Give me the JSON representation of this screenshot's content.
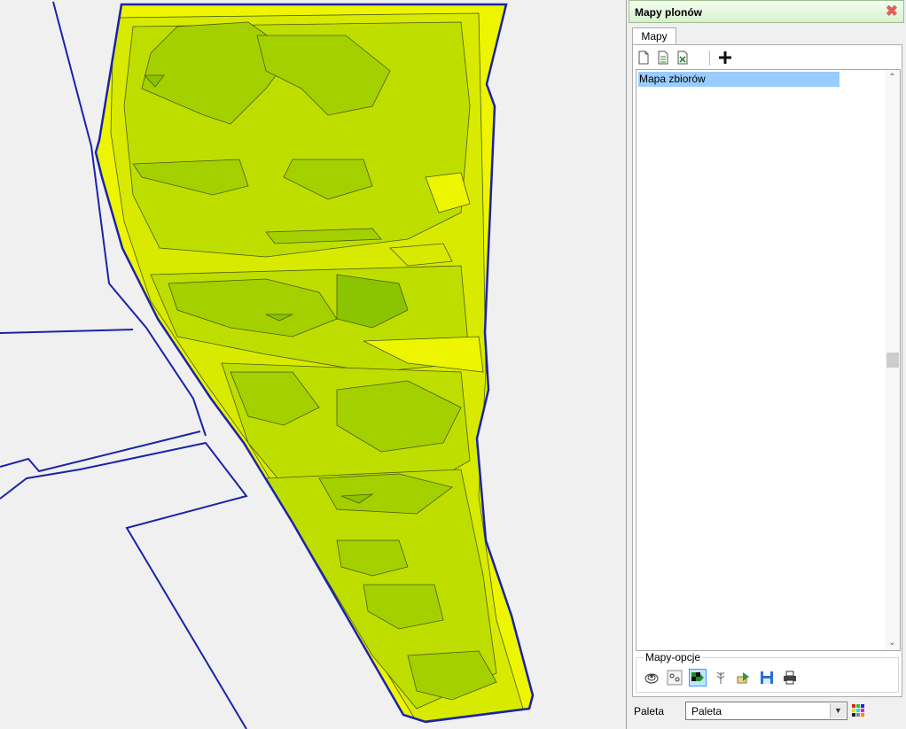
{
  "panel": {
    "title": "Mapy plonów",
    "close_icon": "close-icon",
    "tab_label": "Mapy",
    "toolbar_icons": [
      "new-document-icon",
      "edit-document-icon",
      "delete-document-icon",
      "add-icon"
    ],
    "list_items": [
      "Mapa zbiorów"
    ],
    "options_label": "Mapy-opcje",
    "option_icons": [
      "layers-icon",
      "points-icon",
      "map-grid-icon",
      "crop-icon",
      "export-icon",
      "save-icon",
      "print-icon"
    ],
    "palette_label": "Paleta",
    "palette_value": "Paleta",
    "palette_icon": "palette-icon"
  },
  "colors": {
    "boundary": "#1a23a8",
    "header_bg": "#dff3d6",
    "selection": "#99ccff",
    "zone_levels": [
      "#eef500",
      "#d7ea00",
      "#bede00",
      "#a4d000",
      "#8bc400"
    ]
  }
}
